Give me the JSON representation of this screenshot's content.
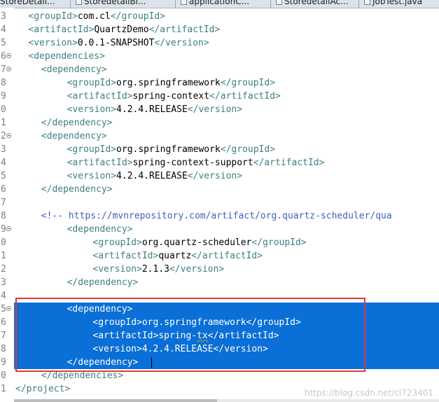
{
  "editor_tabs": [
    {
      "label": "StoreDetail..."
    },
    {
      "label": "StoredetailBi..."
    },
    {
      "label": "applicationC..."
    },
    {
      "label": "StoredetailAc..."
    },
    {
      "label": "JobTest.java"
    }
  ],
  "lines": [
    {
      "num": "3",
      "fold": false,
      "selected": false,
      "indent": 2,
      "parts": [
        {
          "t": "<groupId>",
          "c": "tag"
        },
        {
          "t": "com.cl",
          "c": "txt"
        },
        {
          "t": "</groupId>",
          "c": "tag"
        }
      ]
    },
    {
      "num": "4",
      "fold": false,
      "selected": false,
      "indent": 2,
      "parts": [
        {
          "t": "<artifactId>",
          "c": "tag"
        },
        {
          "t": "QuartzDemo",
          "c": "txt"
        },
        {
          "t": "</artifactId>",
          "c": "tag"
        }
      ]
    },
    {
      "num": "5",
      "fold": false,
      "selected": false,
      "indent": 2,
      "parts": [
        {
          "t": "<version>",
          "c": "tag"
        },
        {
          "t": "0.0.1-SNAPSHOT",
          "c": "txt"
        },
        {
          "t": "</version>",
          "c": "tag"
        }
      ]
    },
    {
      "num": "6",
      "fold": true,
      "selected": false,
      "indent": 2,
      "parts": [
        {
          "t": "<dependencies>",
          "c": "tag"
        }
      ]
    },
    {
      "num": "7",
      "fold": true,
      "selected": false,
      "indent": 4,
      "parts": [
        {
          "t": "<dependency>",
          "c": "tag"
        }
      ]
    },
    {
      "num": "8",
      "fold": false,
      "selected": false,
      "indent": 8,
      "parts": [
        {
          "t": "<groupId>",
          "c": "tag"
        },
        {
          "t": "org.springframework",
          "c": "txt"
        },
        {
          "t": "</groupId>",
          "c": "tag"
        }
      ]
    },
    {
      "num": "9",
      "fold": false,
      "selected": false,
      "indent": 8,
      "parts": [
        {
          "t": "<artifactId>",
          "c": "tag"
        },
        {
          "t": "spring-context",
          "c": "txt"
        },
        {
          "t": "</artifactId>",
          "c": "tag"
        }
      ]
    },
    {
      "num": "0",
      "fold": false,
      "selected": false,
      "indent": 8,
      "parts": [
        {
          "t": "<version>",
          "c": "tag"
        },
        {
          "t": "4.2.4.RELEASE",
          "c": "txt"
        },
        {
          "t": "</version>",
          "c": "tag"
        }
      ]
    },
    {
      "num": "1",
      "fold": false,
      "selected": false,
      "indent": 4,
      "parts": [
        {
          "t": "</dependency>",
          "c": "tag"
        }
      ]
    },
    {
      "num": "2",
      "fold": true,
      "selected": false,
      "indent": 4,
      "parts": [
        {
          "t": "<dependency>",
          "c": "tag"
        }
      ]
    },
    {
      "num": "3",
      "fold": false,
      "selected": false,
      "indent": 8,
      "parts": [
        {
          "t": "<groupId>",
          "c": "tag"
        },
        {
          "t": "org.springframework",
          "c": "txt"
        },
        {
          "t": "</groupId>",
          "c": "tag"
        }
      ]
    },
    {
      "num": "4",
      "fold": false,
      "selected": false,
      "indent": 8,
      "parts": [
        {
          "t": "<artifactId>",
          "c": "tag"
        },
        {
          "t": "spring-context-support",
          "c": "txt"
        },
        {
          "t": "</artifactId>",
          "c": "tag"
        }
      ]
    },
    {
      "num": "5",
      "fold": false,
      "selected": false,
      "indent": 8,
      "parts": [
        {
          "t": "<version>",
          "c": "tag"
        },
        {
          "t": "4.2.4.RELEASE",
          "c": "txt"
        },
        {
          "t": "</version>",
          "c": "tag"
        }
      ]
    },
    {
      "num": "6",
      "fold": false,
      "selected": false,
      "indent": 4,
      "parts": [
        {
          "t": "</dependency>",
          "c": "tag"
        }
      ]
    },
    {
      "num": "7",
      "fold": false,
      "selected": false,
      "indent": 0,
      "parts": []
    },
    {
      "num": "8",
      "fold": false,
      "selected": false,
      "indent": 4,
      "parts": [
        {
          "t": "<!-- https://mvnrepository.com/artifact/org.quartz-scheduler/qua",
          "c": "cmt"
        }
      ]
    },
    {
      "num": "9",
      "fold": true,
      "selected": false,
      "indent": 8,
      "parts": [
        {
          "t": "<dependency>",
          "c": "tag"
        }
      ]
    },
    {
      "num": "0",
      "fold": false,
      "selected": false,
      "indent": 12,
      "parts": [
        {
          "t": "<groupId>",
          "c": "tag"
        },
        {
          "t": "org.quartz-scheduler",
          "c": "txt"
        },
        {
          "t": "</groupId>",
          "c": "tag"
        }
      ]
    },
    {
      "num": "1",
      "fold": false,
      "selected": false,
      "indent": 12,
      "parts": [
        {
          "t": "<artifactId>",
          "c": "tag"
        },
        {
          "t": "quartz",
          "c": "txt"
        },
        {
          "t": "</artifactId>",
          "c": "tag"
        }
      ]
    },
    {
      "num": "2",
      "fold": false,
      "selected": false,
      "indent": 12,
      "parts": [
        {
          "t": "<version>",
          "c": "tag"
        },
        {
          "t": "2.1.3",
          "c": "txt"
        },
        {
          "t": "</version>",
          "c": "tag"
        }
      ]
    },
    {
      "num": "3",
      "fold": false,
      "selected": false,
      "indent": 8,
      "parts": [
        {
          "t": "</dependency>",
          "c": "tag"
        }
      ]
    },
    {
      "num": "4",
      "fold": false,
      "selected": false,
      "indent": 0,
      "parts": []
    },
    {
      "num": "5",
      "fold": true,
      "selected": true,
      "indent": 8,
      "parts": [
        {
          "t": "<dependency>",
          "c": "tag"
        }
      ]
    },
    {
      "num": "6",
      "fold": false,
      "selected": true,
      "indent": 12,
      "parts": [
        {
          "t": "<groupId>",
          "c": "tag"
        },
        {
          "t": "org.springframework",
          "c": "txt"
        },
        {
          "t": "</groupId>",
          "c": "tag"
        }
      ]
    },
    {
      "num": "7",
      "fold": false,
      "selected": true,
      "indent": 12,
      "parts": [
        {
          "t": "<artifactId>",
          "c": "tag"
        },
        {
          "t": "spring-",
          "c": "txt"
        },
        {
          "t": "tx",
          "c": "txt",
          "squiggle": true
        },
        {
          "t": "</artifactId>",
          "c": "tag"
        }
      ]
    },
    {
      "num": "8",
      "fold": false,
      "selected": true,
      "indent": 12,
      "parts": [
        {
          "t": "<version>",
          "c": "tag"
        },
        {
          "t": "4.2.4.RELEASE",
          "c": "txt"
        },
        {
          "t": "</version>",
          "c": "tag"
        }
      ]
    },
    {
      "num": "9",
      "fold": false,
      "selected": true,
      "indent": 8,
      "parts": [
        {
          "t": "</dependency>",
          "c": "tag"
        }
      ]
    },
    {
      "num": "0",
      "fold": false,
      "selected": false,
      "indent": 4,
      "parts": [
        {
          "t": "</dependencies>",
          "c": "tag"
        }
      ]
    },
    {
      "num": "1",
      "fold": false,
      "selected": false,
      "indent": 0,
      "parts": [
        {
          "t": "</project>",
          "c": "tag"
        }
      ]
    }
  ],
  "watermark": "https://blog.csdn.net/cl723401"
}
